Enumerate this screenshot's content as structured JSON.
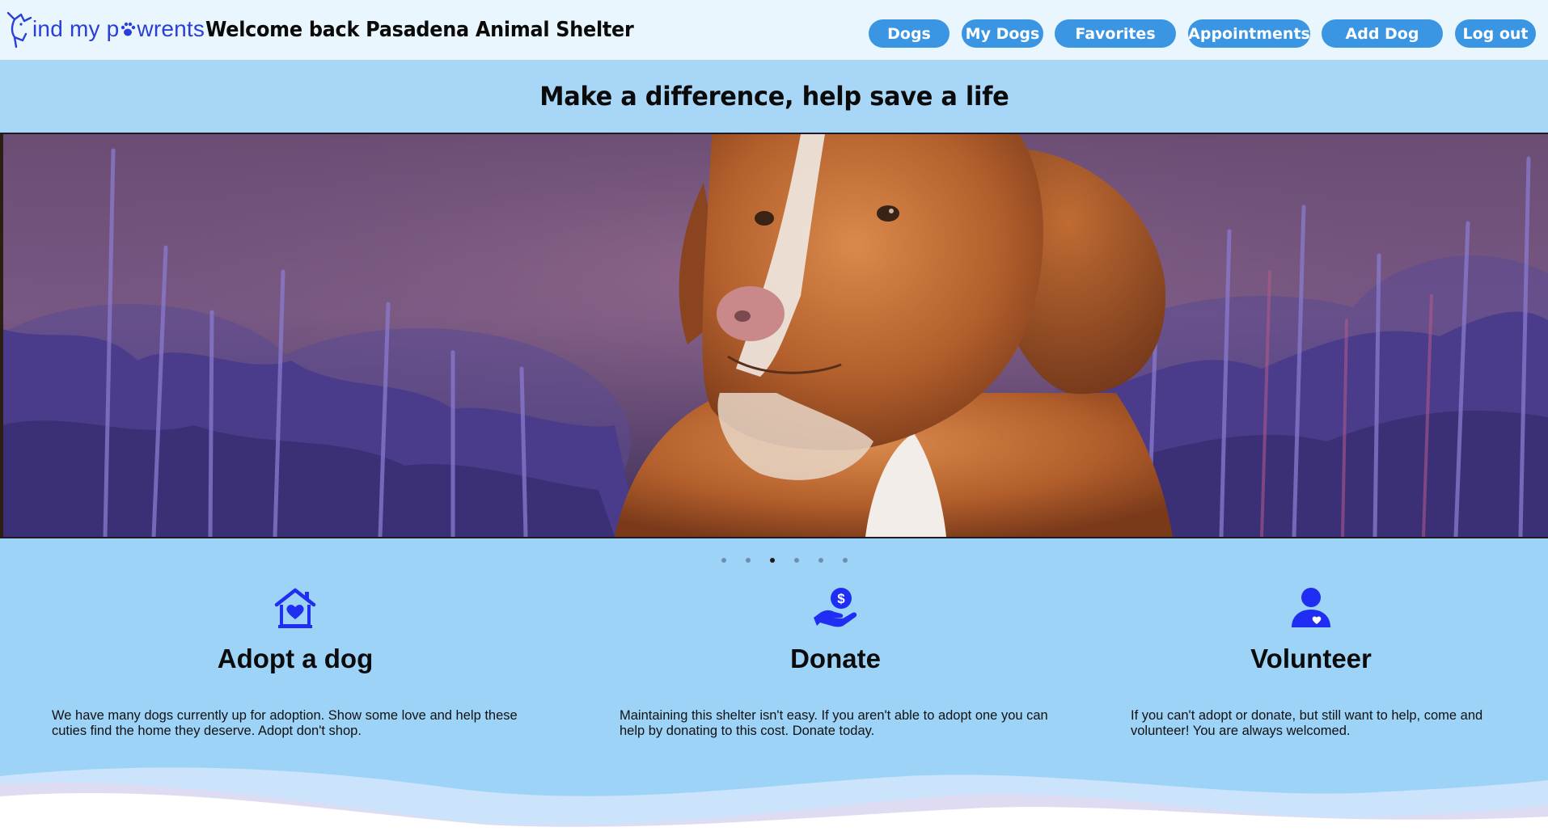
{
  "navbar": {
    "logo": {
      "text_before": "ind my p",
      "text_after": "wrents",
      "icon": "dog-head-logo",
      "paw_icon": "paw-icon"
    },
    "welcome": "Welcome back Pasadena Animal Shelter",
    "buttons": [
      "Dogs",
      "My Dogs",
      "Favorites",
      "Appointments",
      "Add Dog",
      "Log out"
    ]
  },
  "tagline": "Make a difference, help save a life",
  "carousel": {
    "slide_count": 6,
    "active_index": 2
  },
  "features": [
    {
      "icon": "house-heart-icon",
      "title": "Adopt a dog",
      "text": "We have many dogs currently up for adoption. Show some love and help these cuties find the home they deserve. Adopt don't shop."
    },
    {
      "icon": "hand-dollar-icon",
      "title": "Donate",
      "text": "Maintaining this shelter isn't easy. If you aren't able to adopt one you can help by donating to this cost. Donate today."
    },
    {
      "icon": "person-heart-icon",
      "title": "Volunteer",
      "text": "If you can't adopt or donate, but still want to help, come and volunteer! You are always welcomed."
    }
  ],
  "colors": {
    "navbar_bg": "#e9f6fd",
    "tagline_bg": "#a8d6f6",
    "section_bg": "#9ed3f8",
    "button_bg": "#3a95e2",
    "icon_blue": "#1f2ef2",
    "logo_blue": "#2a3fd6"
  }
}
